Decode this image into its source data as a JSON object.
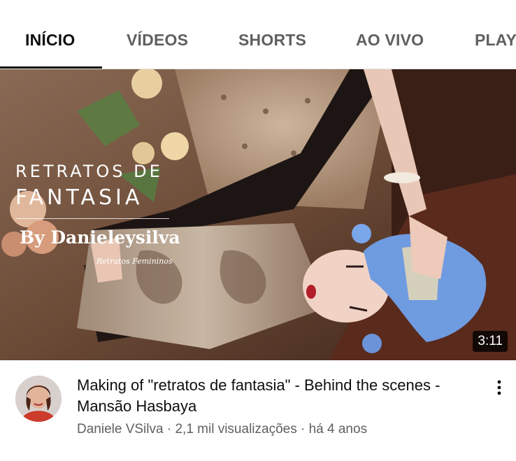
{
  "tabs": [
    {
      "label": "INÍCIO",
      "active": true
    },
    {
      "label": "VÍDEOS",
      "active": false
    },
    {
      "label": "SHORTS",
      "active": false
    },
    {
      "label": "AO VIVO",
      "active": false
    },
    {
      "label": "PLAY",
      "active": false
    }
  ],
  "video": {
    "thumbnail": {
      "title_line1": "RETRATOS DE",
      "title_line2": "FANTASIA",
      "byline": "By Danieleysilva",
      "subtitle": "Retratos Femininos"
    },
    "duration": "3:11",
    "title": "Making of \"retratos de fantasia\" - Behind the scenes - Mansão Hasbaya",
    "channel": "Daniele VSilva",
    "separator": " · ",
    "views": "2,1 mil visualizações",
    "age": "há 4 anos"
  },
  "icons": {
    "more": "more-vert-icon",
    "avatar": "channel-avatar"
  },
  "colors": {
    "active_tab": "#0f0f0f",
    "inactive_tab": "#606060",
    "meta_text": "#606060",
    "divider": "#e5e5e5"
  }
}
